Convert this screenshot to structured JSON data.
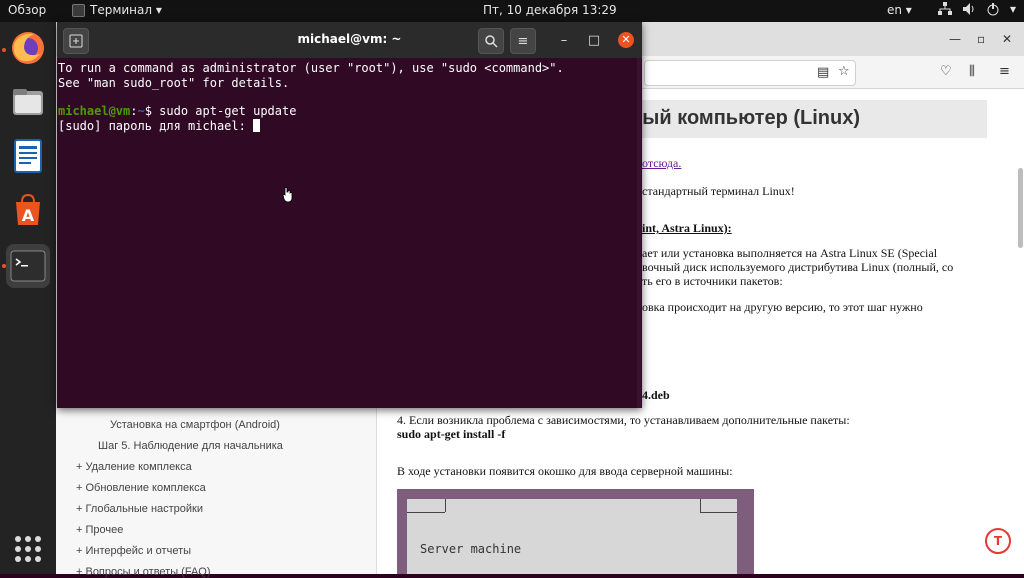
{
  "topbar": {
    "overview": "Обзор",
    "app_name": "Терминал ▾",
    "clock": "Пт, 10 декабря  13:29",
    "lang": "en ▾",
    "tray_icons": [
      "network-icon",
      "volume-icon",
      "power-icon"
    ]
  },
  "dock": {
    "items": [
      "firefox-icon",
      "files-icon",
      "writer-icon",
      "software-icon",
      "terminal-icon"
    ],
    "accent": "#e95420"
  },
  "terminal": {
    "title": "michael@vm: ~",
    "lines": [
      "To run a command as administrator (user \"root\"), use \"sudo <command>\".",
      "See \"man sudo_root\" for details."
    ],
    "prompt_user": "michael@vm",
    "prompt_sep": ":",
    "prompt_path": "~",
    "prompt_dollar": "$ ",
    "command": "sudo apt-get update",
    "password_prompt": "[sudo] пароль для michael: ",
    "background": "#300a24"
  },
  "browser": {
    "heading_partial": "ый компьютер (Linux)",
    "content_lines": [
      "отсюда.",
      "стандартный терминал Linux!",
      "int, Astra Linux):",
      "ает или установка выполняется на Astra Linux SE (Special",
      "вочный диск используемого дистрибутива Linux (полный, со",
      "ть его в источники пакетов:",
      "овка происходит на другую версию, то этот шаг нужно",
      "4.deb",
      "4. Если возникла проблема с зависимостями, то устанавливаем дополнительные пакеты:",
      "sudo apt-get install -f",
      "В ходе установки появится окошко для ввода серверной машины:"
    ],
    "image_text": "Server machine",
    "sidebar_items": [
      "Установка на смартфон (Android)",
      "Шаг 5. Наблюдение для начальника",
      "+ Удаление комплекса",
      "+ Обновление комплекса",
      "+ Глобальные настройки",
      "+ Прочее",
      "+ Интерфейс и отчеты",
      "+ Вопросы и ответы (FAQ)"
    ]
  }
}
